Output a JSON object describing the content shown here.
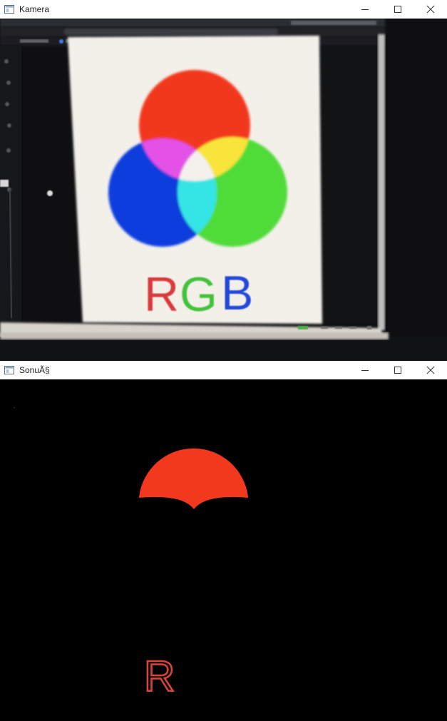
{
  "windows": {
    "kamera": {
      "title": "Kamera",
      "icon": "opencv-window-icon"
    },
    "sonuc": {
      "title": "SonuÃ§",
      "icon": "opencv-window-icon"
    }
  },
  "controls": {
    "minimize": "minimize-icon",
    "maximize": "maximize-icon",
    "close": "close-icon"
  },
  "camera_feed": {
    "poster_text": "RGB",
    "letters": [
      {
        "char": "R",
        "color": "#d83a3a"
      },
      {
        "char": "G",
        "color": "#45c23a"
      },
      {
        "char": "B",
        "color": "#2348d8"
      }
    ],
    "circle_colors": {
      "red": "#f2391e",
      "green": "#4fdc37",
      "blue": "#0a3ddd",
      "magenta": "#e451e6",
      "yellow": "#f8e43a",
      "cyan": "#34e4e4",
      "white": "#f4f1ec"
    }
  },
  "result_mask": {
    "detected_color": "#f2391e",
    "letter": "R",
    "letter_color": "#d84436"
  }
}
